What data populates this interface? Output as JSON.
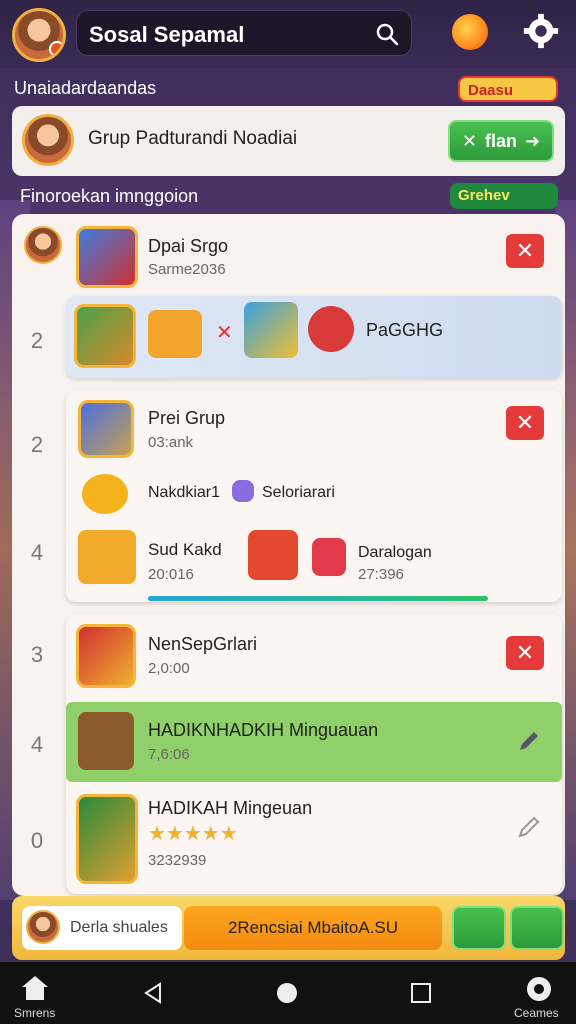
{
  "header": {
    "search_title": "Sosal Sepamal",
    "section_heading": "Unaiadardaandas",
    "deals_pill": "Daasu"
  },
  "group": {
    "name": "Grup Padturandi Noadiai",
    "join_label": "flan"
  },
  "section2": {
    "heading": "Finoroekan imnggoion",
    "pill": "Grehev"
  },
  "rows": [
    {
      "rank": "",
      "title": "Dpai Srgo",
      "sub": "Sarme2036"
    },
    {
      "rank": "2",
      "label": "PaGGHG"
    },
    {
      "rank": "2",
      "title": "Prei Grup",
      "sub": "03:ank"
    },
    {
      "line": "Nakdkiar1",
      "line2": "Seloriarari"
    },
    {
      "rank": "4",
      "title": "Sud Kakd",
      "sub": "20:016",
      "title2": "Daralogan",
      "sub2": "27:396"
    },
    {
      "rank": "3",
      "title": "NenSepGrlari",
      "sub": "2,0:00"
    },
    {
      "rank": "4",
      "title": "HADIKNHADKIH Minguauan",
      "sub": "7,6:06"
    },
    {
      "rank": "0",
      "title": "HADIKAH Mingeuan",
      "sub": "3232939"
    }
  ],
  "promo": {
    "input_text": "Derla shuales",
    "cta": "2Rencsiai MbaitoA.SU"
  },
  "nav": {
    "left_label": "Smrens",
    "right_label": "Ceames"
  },
  "colors": {
    "accent_green": "#2e9a3a",
    "danger_red": "#e53a3a",
    "gold": "#f0b83a"
  }
}
